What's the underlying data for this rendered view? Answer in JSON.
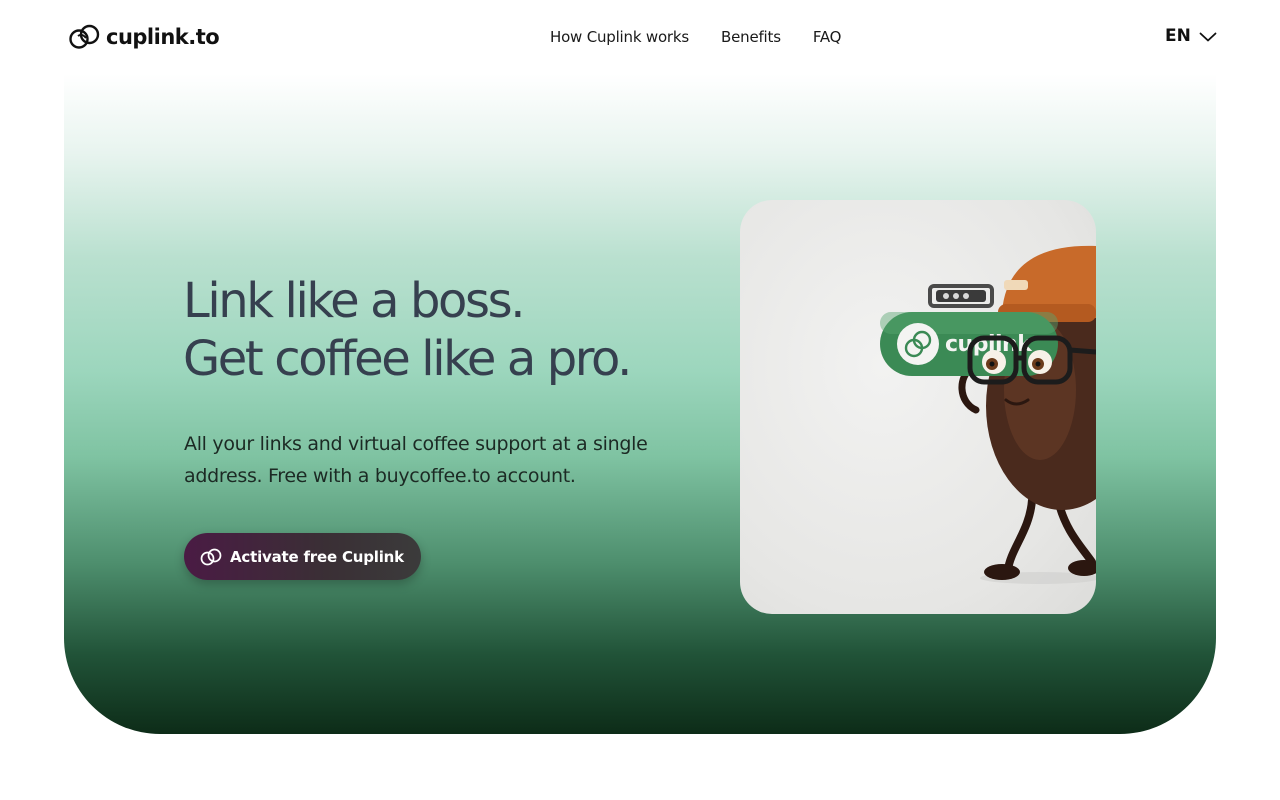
{
  "header": {
    "logo_text": "cuplink.to",
    "logo_icon": "coffee-cup-link-icon",
    "nav": [
      {
        "label": "How Cuplink works"
      },
      {
        "label": "Benefits"
      },
      {
        "label": "FAQ"
      }
    ],
    "language": {
      "label": "EN",
      "icon": "chevron-down-icon"
    }
  },
  "hero": {
    "headline_line1": "Link like a boss.",
    "headline_line2": "Get coffee like a pro.",
    "subtext": "All your links and virtual coffee support at a single address. Free with a buycoffee.to account.",
    "cta_label": "Activate free Cuplink",
    "cta_icon": "cuplink-icon",
    "illustration": {
      "description_icon": "coffee-bean-mascot-illustration",
      "pill_text": "cuplink"
    }
  },
  "colors": {
    "headline": "#36404f",
    "cta_start": "#4a1b44",
    "cta_end": "#3b3b3b",
    "hero_top": "#ffffff",
    "hero_mid": "#9cd6bd",
    "hero_bottom": "#0d2c18",
    "pill_green": "#3b8a55",
    "hat_orange": "#c86a2a"
  }
}
